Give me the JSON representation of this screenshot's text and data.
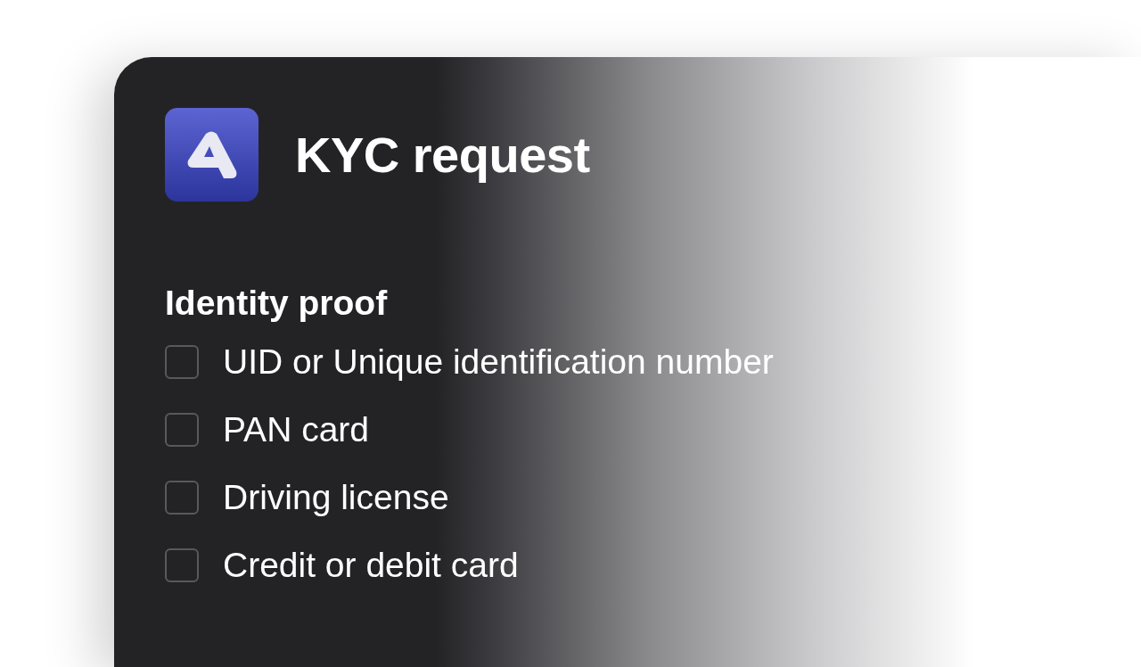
{
  "header": {
    "title": "KYC request"
  },
  "section": {
    "title": "Identity proof",
    "options": [
      {
        "label": "UID or Unique identification number",
        "checked": false
      },
      {
        "label": "PAN card",
        "checked": false
      },
      {
        "label": "Driving license",
        "checked": false
      },
      {
        "label": "Credit or debit card",
        "checked": false
      }
    ]
  }
}
